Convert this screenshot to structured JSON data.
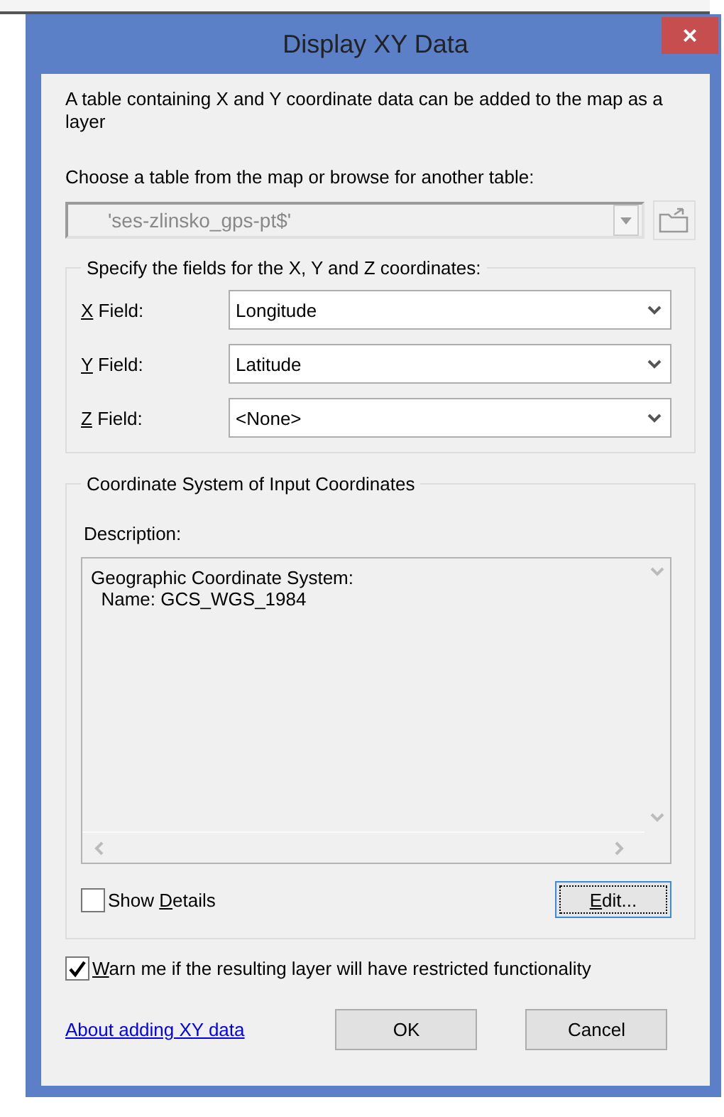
{
  "window": {
    "title": "Display XY Data",
    "close": "×"
  },
  "intro": "A table containing X and Y coordinate data can be added to the map as a layer",
  "table_prompt": "Choose a table from the map or browse for another table:",
  "table_combo": {
    "value": "'ses-zlinsko_gps-pt$'",
    "disabled": true
  },
  "fields_group": {
    "legend": "Specify the fields for the X, Y and Z coordinates:",
    "rows": [
      {
        "access_key": "X",
        "label_rest": " Field:",
        "value": "Longitude"
      },
      {
        "access_key": "Y",
        "label_rest": " Field:",
        "value": "Latitude"
      },
      {
        "access_key": "Z",
        "label_rest": " Field:",
        "value": "<None>"
      }
    ]
  },
  "coord_group": {
    "legend": "Coordinate System of Input Coordinates",
    "description_label": "Description:",
    "description_lines": [
      "Geographic Coordinate System:",
      "  Name: GCS_WGS_1984"
    ],
    "show_details": {
      "before": "Show ",
      "access_key": "D",
      "after": "etails",
      "checked": false
    },
    "edit_button": {
      "access_key": "E",
      "after": "dit...",
      "focused": true
    }
  },
  "warn": {
    "access_key": "W",
    "after": "arn me if the resulting layer will have restricted functionality",
    "checked": true
  },
  "help_link": "About adding XY data",
  "buttons": [
    "OK",
    "Cancel"
  ]
}
